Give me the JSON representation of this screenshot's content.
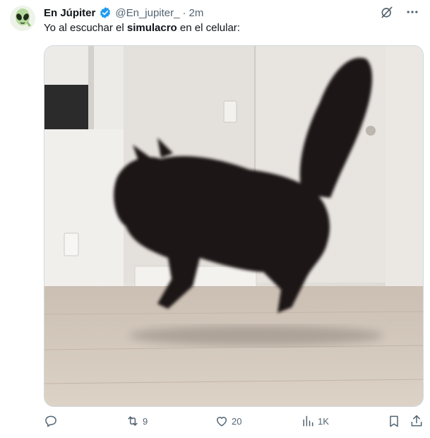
{
  "tweet": {
    "display_name": "En Júpiter",
    "handle": "@En_jupiter_",
    "separator": "·",
    "time": "2m",
    "text_before": "Yo al escuchar el ",
    "text_bold": "simulacro",
    "text_after": " en el celular:"
  },
  "icons": {
    "avatar": "alien-emoji-icon",
    "verified": "verified-badge-icon",
    "grok": "grok-icon",
    "more": "more-icon",
    "reply": "reply-icon",
    "retweet": "retweet-icon",
    "like": "like-icon",
    "views": "views-icon",
    "bookmark": "bookmark-icon",
    "share": "share-icon"
  },
  "metrics": {
    "replies": "",
    "retweets": "9",
    "likes": "20",
    "views": "1K"
  },
  "colors": {
    "verified_blue": "#1d9bf0",
    "secondary_text": "#536471"
  }
}
